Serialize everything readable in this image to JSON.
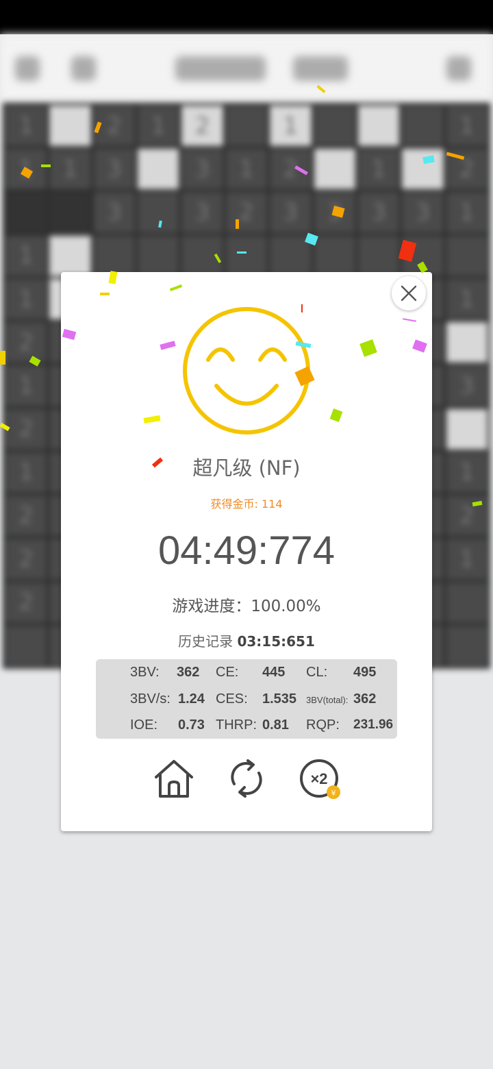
{
  "board": {
    "rows": [
      [
        "1",
        "",
        "2",
        "1",
        "2",
        "",
        "1",
        "",
        "",
        "",
        "1"
      ],
      [
        "1",
        "1",
        "3",
        "",
        "3",
        "1",
        "2",
        "",
        "1",
        "",
        "2"
      ],
      [
        "",
        "",
        "3",
        "",
        "3",
        "2",
        "3",
        "3",
        "3",
        "3",
        "1"
      ],
      [
        "1",
        "",
        "",
        "",
        "",
        "",
        "",
        "",
        "",
        "",
        ""
      ],
      [
        "1",
        "",
        "",
        "",
        "",
        "",
        "",
        "",
        "",
        "",
        "1"
      ],
      [
        "2",
        "",
        "",
        "",
        "",
        "",
        "",
        "",
        "",
        "",
        ""
      ],
      [
        "1",
        "",
        "",
        "",
        "",
        "",
        "",
        "",
        "",
        "",
        "3"
      ],
      [
        "2",
        "",
        "",
        "",
        "",
        "",
        "",
        "",
        "",
        "",
        ""
      ],
      [
        "1",
        "",
        "",
        "",
        "",
        "",
        "",
        "",
        "",
        "",
        "1"
      ],
      [
        "2",
        "",
        "",
        "",
        "",
        "",
        "",
        "",
        "",
        "",
        "2"
      ],
      [
        "2",
        "",
        "",
        "",
        "",
        "",
        "",
        "",
        "",
        "",
        "1"
      ],
      [
        "2",
        "",
        "",
        "",
        "",
        "",
        "",
        "",
        "",
        "",
        ""
      ],
      [
        "",
        "",
        "",
        "",
        "",
        "",
        "",
        "",
        "",
        "",
        ""
      ]
    ]
  },
  "result": {
    "level": "超凡级 (NF)",
    "coins_label": "获得金币: 114",
    "time": "04:49:774",
    "progress_label": "游戏进度：100.00%",
    "history_label": "历史记录",
    "history_value": "03:15:651"
  },
  "stats": {
    "bv_label": "3BV:",
    "bv": "362",
    "ce_label": "CE:",
    "ce": "445",
    "cl_label": "CL:",
    "cl": "495",
    "bvs_label": "3BV/s:",
    "bvs": "1.24",
    "ces_label": "CES:",
    "ces": "1.535",
    "bvt_label": "3BV(total):",
    "bvt": "362",
    "ioe_label": "IOE:",
    "ioe": "0.73",
    "thrp_label": "THRP:",
    "thrp": "0.81",
    "rqp_label": "RQP:",
    "rqp": "231.96"
  },
  "actions": {
    "home_icon": "home-icon",
    "restart_icon": "restart-icon",
    "double_icon": "double-reward-icon",
    "double_text": "×2",
    "coin_symbol": "¥"
  },
  "colors": {
    "smiley": "#f5c400",
    "coins": "#f08a24",
    "coin_badge": "#f3b21a"
  }
}
